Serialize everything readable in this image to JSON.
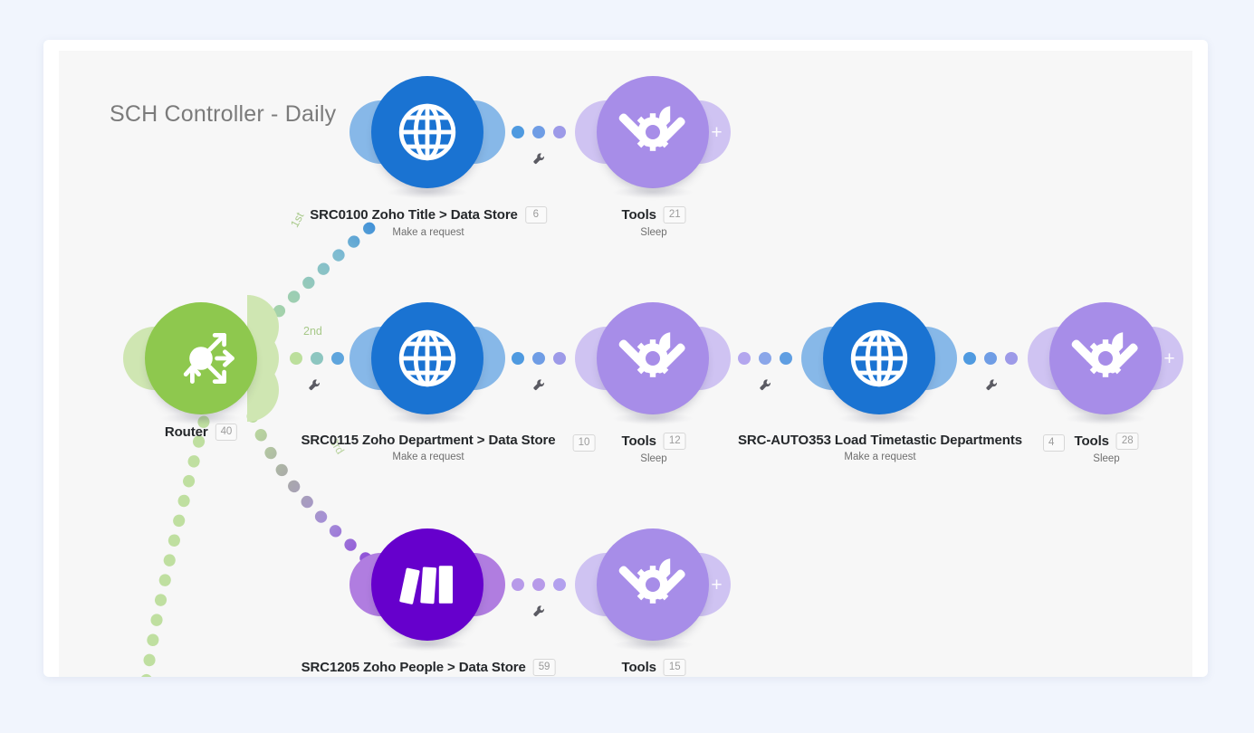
{
  "scenario": {
    "title": "SCH Controller - Daily",
    "canvas_bg": "#f7f7f7",
    "page_bg": "#f1f5fd"
  },
  "colors": {
    "router_green": "#8ec84e",
    "router_green_light": "#cfe6b2",
    "http_blue": "#1a73d2",
    "http_blue_light": "#87b8e8",
    "tools_purple": "#a78de8",
    "tools_purple_light": "#cfc3f2",
    "people_purple": "#6600cc",
    "people_purple_light": "#b07de0",
    "badge_text": "#9b9b9b",
    "label_text": "#25282b",
    "sub_text": "#6f6f6f",
    "title_text": "#7b7b7b",
    "ordinal_green": "#a8c98a"
  },
  "ordinals": [
    {
      "key": "first",
      "label": "1st"
    },
    {
      "key": "second",
      "label": "2nd"
    },
    {
      "key": "third",
      "label": "3rd"
    }
  ],
  "router": {
    "name": "Router",
    "badge": "40",
    "icon": "router-arrows-icon"
  },
  "rows": [
    {
      "id": "row-1",
      "nodes": [
        {
          "icon": "globe-http-icon",
          "kind": "http",
          "title": "SRC0100 Zoho Title > Data Store",
          "badge": "6",
          "subtitle": "Make a request",
          "has_plus": false
        },
        {
          "icon": "tools-icon",
          "kind": "tools",
          "title": "Tools",
          "badge": "21",
          "subtitle": "Sleep",
          "has_plus": true
        }
      ]
    },
    {
      "id": "row-2",
      "nodes": [
        {
          "icon": "globe-http-icon",
          "kind": "http",
          "title": "SRC0115 Zoho Department > Data Store",
          "badge": "10",
          "badge_position": "right",
          "subtitle": "Make a request",
          "has_plus": false
        },
        {
          "icon": "tools-icon",
          "kind": "tools",
          "title": "Tools",
          "badge": "12",
          "subtitle": "Sleep",
          "has_plus": false
        },
        {
          "icon": "globe-http-icon",
          "kind": "http",
          "title": "SRC-AUTO353 Load Timetastic Departments",
          "badge": "4",
          "badge_position": "right",
          "subtitle": "Make a request",
          "has_plus": false
        },
        {
          "icon": "tools-icon",
          "kind": "tools",
          "title": "Tools",
          "badge": "28",
          "subtitle": "Sleep",
          "has_plus": true
        }
      ]
    },
    {
      "id": "row-3",
      "nodes": [
        {
          "icon": "zoho-people-icon",
          "kind": "people",
          "title": "SRC1205 Zoho People > Data Store",
          "badge": "59",
          "subtitle": "",
          "has_plus": false
        },
        {
          "icon": "tools-icon",
          "kind": "tools",
          "title": "Tools",
          "badge": "15",
          "subtitle": "",
          "has_plus": true
        }
      ]
    }
  ]
}
